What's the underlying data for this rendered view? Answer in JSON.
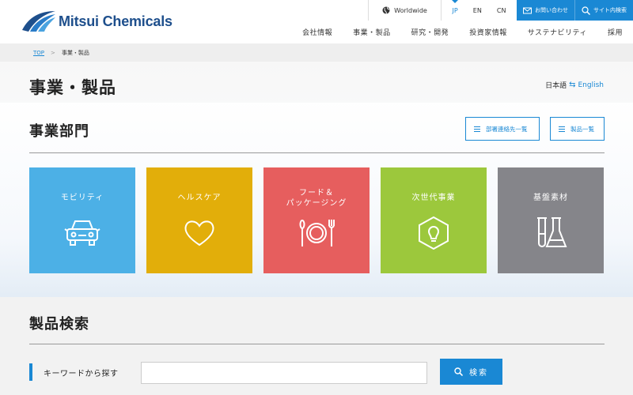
{
  "header": {
    "logo_text": "Mitsui Chemicals",
    "worldwide": "Worldwide",
    "langs": [
      "JP",
      "EN",
      "CN"
    ],
    "contact": "お問い合わせ",
    "site_search": "サイト内検索",
    "nav": [
      "会社情報",
      "事業・製品",
      "研究・開発",
      "投資家情報",
      "サステナビリティ",
      "採用"
    ]
  },
  "breadcrumb": {
    "home": "TOP",
    "current": "事業・製品"
  },
  "page": {
    "title": "事業・製品",
    "lang_ja": "日本語",
    "lang_arrow": "⇆",
    "lang_en": "English"
  },
  "division": {
    "title": "事業部門",
    "btn_contacts": "部署連絡先一覧",
    "btn_products": "製品一覧",
    "tiles": [
      {
        "label": "モビリティ",
        "color": "#4cb0e6",
        "icon": "car-icon"
      },
      {
        "label": "ヘルスケア",
        "color": "#e2ae0a",
        "icon": "heart-icon"
      },
      {
        "label": "フード＆\nパッケージング",
        "color": "#e65e5e",
        "icon": "plate-icon"
      },
      {
        "label": "次世代事業",
        "color": "#9cc83c",
        "icon": "bulb-icon"
      },
      {
        "label": "基盤素材",
        "color": "#85858a",
        "icon": "flask-icon"
      }
    ]
  },
  "search": {
    "title": "製品検索",
    "keyword_label": "キーワードから探す",
    "placeholder": "",
    "button": "検索"
  },
  "colors": {
    "accent": "#1a88d4",
    "logo": "#1e4f8c"
  }
}
